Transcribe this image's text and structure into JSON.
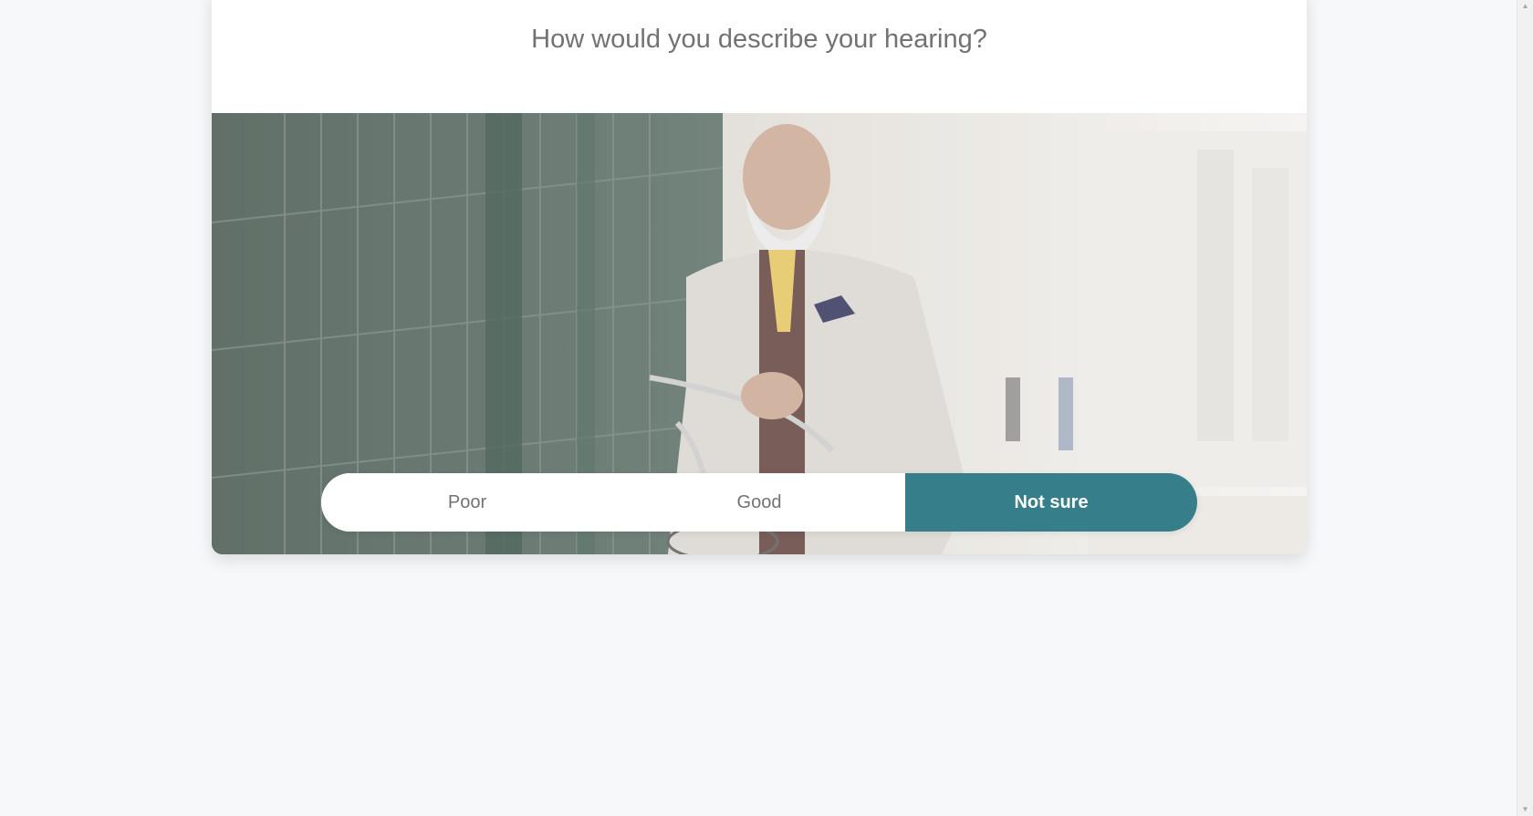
{
  "survey": {
    "question": "How would you describe your hearing?",
    "hero_image_alt": "older-man-with-bicycle-photo",
    "answers": [
      {
        "label": "Poor",
        "selected": false
      },
      {
        "label": "Good",
        "selected": false
      },
      {
        "label": "Not sure",
        "selected": true
      }
    ]
  },
  "colors": {
    "accent": "#367f8a",
    "background": "#f7f8fa",
    "card": "#ffffff",
    "text_muted": "#707274"
  },
  "scrollbar": {
    "up_glyph": "▲",
    "down_glyph": "▼"
  }
}
